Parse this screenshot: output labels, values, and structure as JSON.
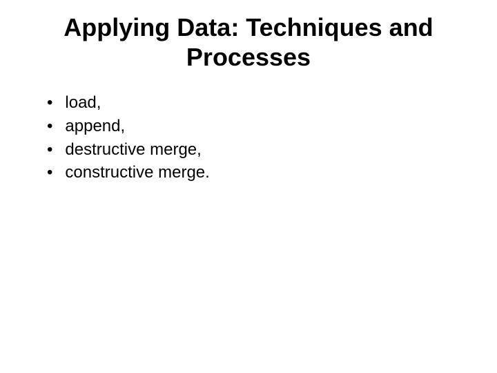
{
  "title": "Applying Data: Techniques and Processes",
  "bullets": {
    "item0": "load,",
    "item1": "append,",
    "item2": "destructive merge,",
    "item3": "constructive merge."
  }
}
